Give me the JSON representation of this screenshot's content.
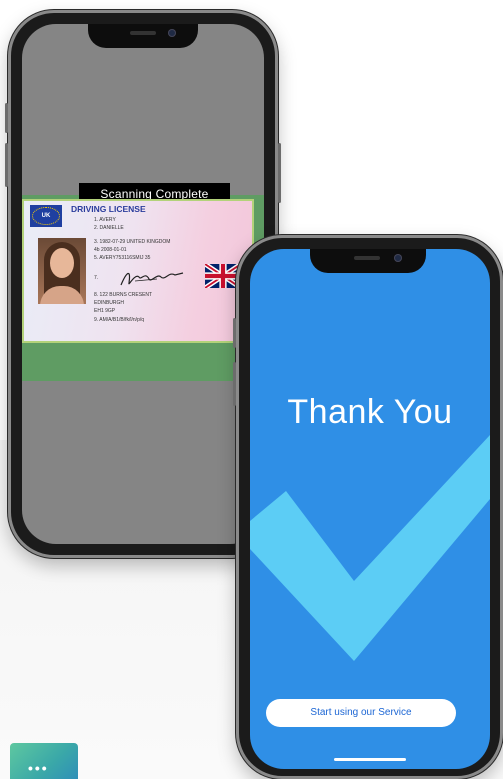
{
  "phone_left": {
    "scan_status": "Scanning Complete",
    "license": {
      "title": "DRIVING LICENSE",
      "country_code": "UK",
      "lines": [
        "1.   AVERY",
        "2.   DANIELLE",
        "3.   1982-07-29 UNITED KINGDOM",
        "4b   2008-01-01",
        "5.        AVERY753116SMIJ 35",
        "7.",
        "8.   122 BURNS CRESENT",
        "      EDINBURGH",
        "      EH1 9GP",
        "9.   AM/A/B1/B/fk/l/n/p/q"
      ]
    }
  },
  "phone_right": {
    "heading": "Thank You",
    "cta_label": "Start using our Service",
    "accent_color": "#2f8fe6",
    "check_color": "#5ccdf5"
  },
  "chat_widget": {
    "icon": "more-dots-icon",
    "glyph": "•••"
  }
}
